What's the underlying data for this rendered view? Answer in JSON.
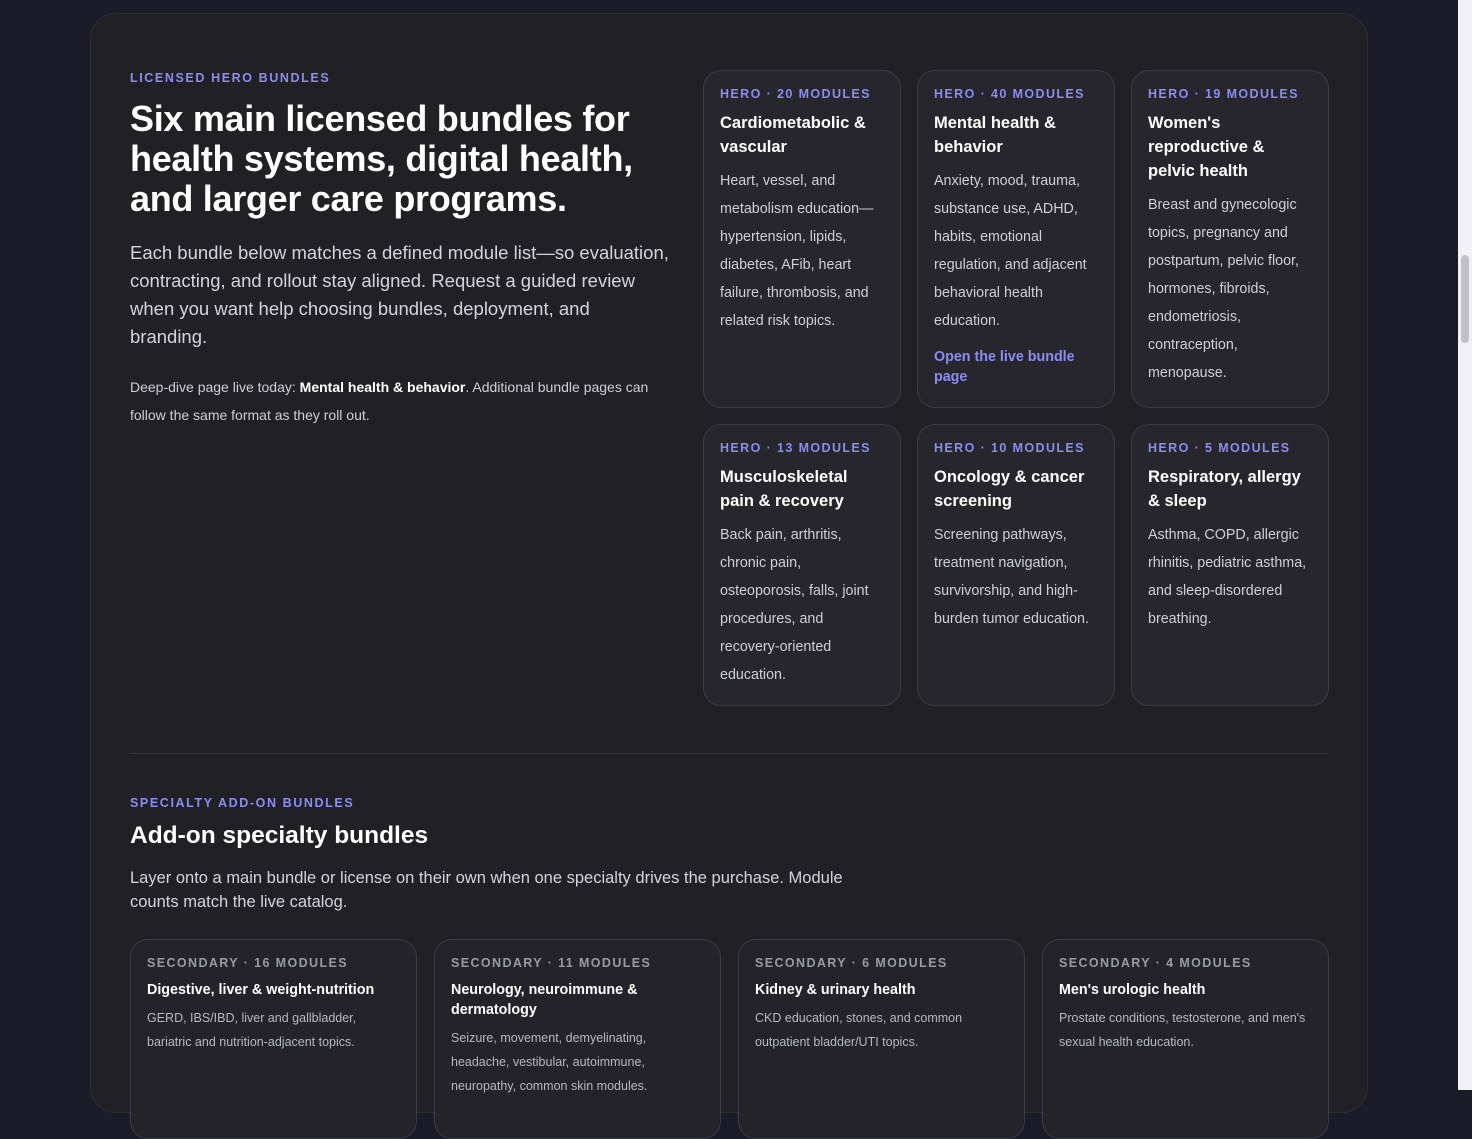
{
  "hero": {
    "eyebrow": "LICENSED HERO BUNDLES",
    "title": "Six main licensed bundles for health systems, digital health, and larger care programs.",
    "lead": "Each bundle below matches a defined module list—so evaluation, contracting, and rollout stay aligned. Request a guided review when you want help choosing bundles, deployment, and branding.",
    "note_prefix": "Deep-dive page live today: ",
    "note_strong": "Mental health & behavior",
    "note_suffix": ". Additional bundle pages can follow the same format as they roll out."
  },
  "hero_bundles": [
    {
      "meta": "HERO · 20 MODULES",
      "title": "Cardiometabolic & vascular",
      "desc": "Heart, vessel, and metabolism education—hypertension, lipids, diabetes, AFib, heart failure, thrombosis, and related risk topics."
    },
    {
      "meta": "HERO · 40 MODULES",
      "title": "Mental health & behavior",
      "desc": "Anxiety, mood, trauma, substance use, ADHD, habits, emotional regulation, and adjacent behavioral health education.",
      "link": "Open the live bundle page"
    },
    {
      "meta": "HERO · 19 MODULES",
      "title": "Women's reproductive & pelvic health",
      "desc": "Breast and gynecologic topics, pregnancy and postpartum, pelvic floor, hormones, fibroids, endometriosis, contraception, menopause."
    },
    {
      "meta": "HERO · 13 MODULES",
      "title": "Musculoskeletal pain & recovery",
      "desc": "Back pain, arthritis, chronic pain, osteoporosis, falls, joint procedures, and recovery-oriented education."
    },
    {
      "meta": "HERO · 10 MODULES",
      "title": "Oncology & cancer screening",
      "desc": "Screening pathways, treatment navigation, survivorship, and high-burden tumor education."
    },
    {
      "meta": "HERO · 5 MODULES",
      "title": "Respiratory, allergy & sleep",
      "desc": "Asthma, COPD, allergic rhinitis, pediatric asthma, and sleep-disordered breathing."
    }
  ],
  "addon": {
    "eyebrow": "SPECIALTY ADD-ON BUNDLES",
    "title": "Add-on specialty bundles",
    "lead": "Layer onto a main bundle or license on their own when one specialty drives the purchase. Module counts match the live catalog."
  },
  "addon_bundles": [
    {
      "meta": "SECONDARY · 16 MODULES",
      "title": "Digestive, liver & weight-nutrition",
      "desc": "GERD, IBS/IBD, liver and gallbladder, bariatric and nutrition-adjacent topics."
    },
    {
      "meta": "SECONDARY · 11 MODULES",
      "title": "Neurology, neuroimmune & dermatology",
      "desc": "Seizure, movement, demyelinating, headache, vestibular, autoimmune, neuropathy, common skin modules."
    },
    {
      "meta": "SECONDARY · 6 MODULES",
      "title": "Kidney & urinary health",
      "desc": "CKD education, stones, and common outpatient bladder/UTI topics."
    },
    {
      "meta": "SECONDARY · 4 MODULES",
      "title": "Men's urologic health",
      "desc": "Prostate conditions, testosterone, and men's sexual health education."
    }
  ]
}
